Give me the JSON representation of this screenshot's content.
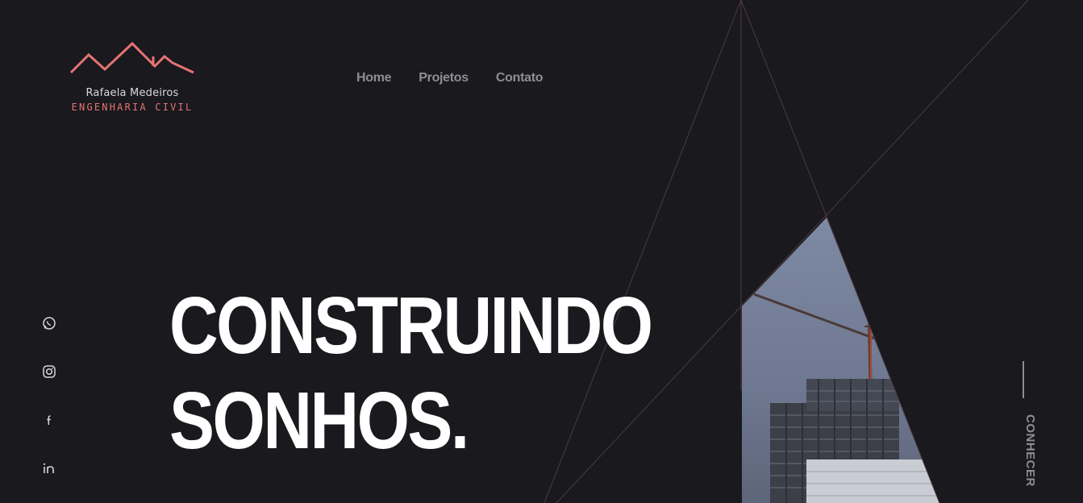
{
  "brand": {
    "name": "Rafaela Medeiros",
    "subtitle": "ENGENHARIA CIVIL",
    "accent_color": "#e57373"
  },
  "nav": {
    "items": [
      {
        "label": "Home"
      },
      {
        "label": "Projetos"
      },
      {
        "label": "Contato"
      }
    ]
  },
  "hero": {
    "line1": "CONSTRUINDO",
    "line2": "SONHOS."
  },
  "social": {
    "icons": [
      "whatsapp-icon",
      "instagram-icon",
      "facebook-icon",
      "linkedin-icon"
    ]
  },
  "cta": {
    "label": "CONHECER"
  },
  "colors": {
    "background": "#19191e",
    "nav_text": "#8d8d93",
    "hero_text": "#ffffff",
    "line_color": "#5a3a40"
  }
}
